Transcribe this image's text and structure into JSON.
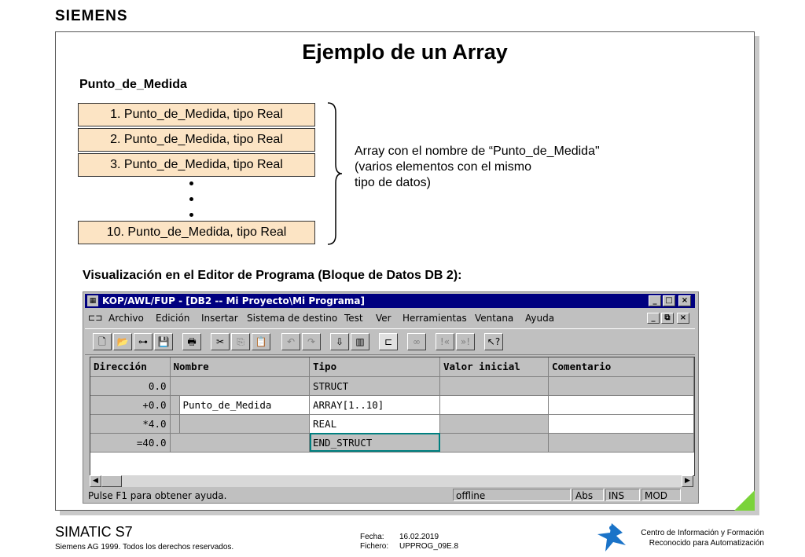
{
  "header": {
    "logo": "SIEMENS"
  },
  "slide": {
    "title": "Ejemplo de un Array",
    "array_label": "Punto_de_Medida",
    "elements": [
      "1. Punto_de_Medida, tipo Real",
      "2. Punto_de_Medida, tipo Real",
      "3. Punto_de_Medida, tipo Real",
      "10. Punto_de_Medida, tipo Real"
    ],
    "description": [
      "Array con el nombre de “Punto_de_Medida\"",
      "(varios elementos con el mismo",
      "tipo de datos)"
    ],
    "editor_caption": "Visualización en el Editor de Programa (Bloque de Datos DB 2):"
  },
  "window": {
    "title": "KOP/AWL/FUP  - [DB2 -- Mi Proyecto\\Mi Programa]",
    "menu": [
      "Archivo",
      "Edición",
      "Insertar",
      "Sistema de destino",
      "Test",
      "Ver",
      "Herramientas",
      "Ventana",
      "Ayuda"
    ],
    "table": {
      "headers": [
        "Dirección",
        "Nombre",
        "Tipo",
        "Valor inicial",
        "Comentario"
      ],
      "rows": [
        {
          "address": "0.0",
          "name": "",
          "type": "STRUCT",
          "initial": "",
          "comment": ""
        },
        {
          "address": "+0.0",
          "name": "Punto_de_Medida",
          "type": "ARRAY[1..10]",
          "initial": "",
          "comment": ""
        },
        {
          "address": "*4.0",
          "name": "",
          "type": "REAL",
          "initial": "",
          "comment": ""
        },
        {
          "address": "=40.0",
          "name": "",
          "type": "END_STRUCT",
          "initial": "",
          "comment": ""
        }
      ]
    },
    "status": {
      "help": "Pulse F1 para obtener ayuda.",
      "mode": "offline",
      "abs": "Abs",
      "ins": "INS",
      "mod": "MOD"
    }
  },
  "footer": {
    "product": "SIMATIC S7",
    "copyright": "Siemens AG 1999. Todos los derechos reservados.",
    "fecha_label": "Fecha:",
    "fecha_value": "16.02.2019",
    "fichero_label": "Fichero:",
    "fichero_value": "UPPROG_09E.8",
    "center_line1": "Centro de Información y Formación",
    "center_line2": "Reconocido para Automatización"
  },
  "colors": {
    "box_fill": "#fce4c4",
    "titlebar": "#000080",
    "corner": "#7ad33a",
    "selection": "#008080",
    "logo_mark": "#1a73c8"
  }
}
